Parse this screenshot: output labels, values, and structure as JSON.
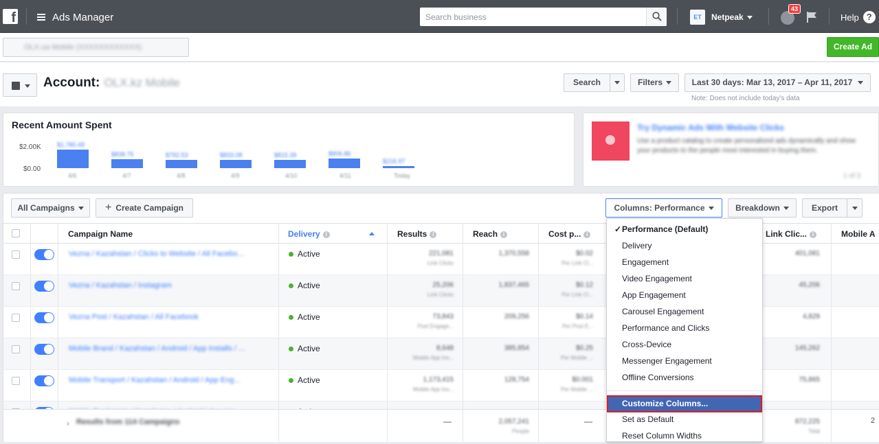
{
  "topbar": {
    "app_title": "Ads Manager",
    "search_placeholder": "Search business",
    "account_name": "Netpeak",
    "account_initials": "ET",
    "notification_count": "43",
    "help_label": "Help",
    "help_icon": "?"
  },
  "subbar": {
    "account_selector_text": "OLX.ua Mobile (XXXXXXXXXXXX)",
    "create_ad_label": "Create Ad"
  },
  "header": {
    "account_label": "Account:",
    "account_name": "OLX.kz Mobile",
    "search_label": "Search",
    "filters_label": "Filters",
    "date_range_label": "Last 30 days: Mar 13, 2017 – Apr 11, 2017",
    "note": "Note: Does not include today's data"
  },
  "spent": {
    "title": "Recent Amount Spent",
    "y_top": "$2.00K",
    "y_bottom": "$0.00"
  },
  "chart_data": {
    "type": "bar",
    "title": "Recent Amount Spent",
    "categories": [
      "4/6",
      "4/7",
      "4/8",
      "4/9",
      "4/10",
      "4/11",
      "Today"
    ],
    "values": [
      1780.49,
      838.75,
      792.53,
      833.08,
      815.39,
      906.86,
      216.97
    ],
    "value_labels": [
      "$1,780.49",
      "$838.75",
      "$792.53",
      "$833.08",
      "$815.39",
      "$906.86",
      "$216.97"
    ],
    "ylim": [
      0,
      2000
    ],
    "tick_labels": [
      "$2.00K",
      "$0.00"
    ]
  },
  "promo": {
    "title": "Try Dynamic Ads With Website Clicks",
    "body": "Use a product catalog to create personalized ads dynamically and show your products to the people most interested in buying them.",
    "pager": "1 of 3"
  },
  "toolbar": {
    "all_campaigns_label": "All Campaigns",
    "create_campaign_label": "Create Campaign",
    "columns_label": "Columns: Performance",
    "breakdown_label": "Breakdown",
    "export_label": "Export"
  },
  "table": {
    "headers": {
      "campaign_name": "Campaign Name",
      "delivery": "Delivery",
      "results": "Results",
      "reach": "Reach",
      "cost": "Cost p...",
      "link_clicks": "Link Clic...",
      "mobile": "Mobile A"
    },
    "rows": [
      {
        "name": "Vezna / Kazahstan / Clicks to Website / All Facebo...",
        "status": "Active",
        "results": "221,081",
        "results_sub": "Link Clicks",
        "reach": "1,370,558",
        "cost": "$0.02",
        "cost_sub": "Per Link Cl...",
        "link_clicks": "401,081"
      },
      {
        "name": "Vezna / Kazahstan / Instagram",
        "status": "Active",
        "results": "25,206",
        "results_sub": "Link Clicks",
        "reach": "1,837,465",
        "cost": "$0.12",
        "cost_sub": "Per Link Cl...",
        "link_clicks": "45,206"
      },
      {
        "name": "Vezna Post / Kazahstan / All Facebook",
        "status": "Active",
        "results": "73,843",
        "results_sub": "Post Engage...",
        "reach": "209,256",
        "cost": "$0.14",
        "cost_sub": "Per Post E...",
        "link_clicks": "4,829"
      },
      {
        "name": "Mobile Brand / Kazahstan / Android / App Installs / ...",
        "status": "Active",
        "results": "8,648",
        "results_sub": "Mobile App Ins...",
        "reach": "385,854",
        "cost": "$0.25",
        "cost_sub": "Per Mobile ...",
        "link_clicks": "145,262"
      },
      {
        "name": "Mobile Transport / Kazahstan / Android / App Eng...",
        "status": "Active",
        "results": "1,173,415",
        "results_sub": "Mobile App Ins...",
        "reach": "128,754",
        "cost": "$0.001",
        "cost_sub": "Per Mobile ...",
        "link_clicks": "75,865"
      },
      {
        "name": "Mobile Realestate / Kazahstan / Android / App Ins...",
        "status": "Active"
      }
    ],
    "footer": {
      "label": "Results from 114 Campaigns",
      "results": "—",
      "reach": "2,057,241",
      "reach_sub": "People",
      "cost": "—",
      "link_clicks": "872,225",
      "link_clicks_sub": "Total",
      "mobile": "2"
    }
  },
  "columns_menu": {
    "check_mark": "✓",
    "items": [
      "Performance (Default)",
      "Delivery",
      "Engagement",
      "Video Engagement",
      "App Engagement",
      "Carousel Engagement",
      "Performance and Clicks",
      "Cross-Device",
      "Messenger Engagement",
      "Offline Conversions"
    ],
    "customize_label": "Customize Columns...",
    "set_default_label": "Set as Default",
    "reset_label": "Reset Column Widths"
  },
  "colors": {
    "topbar": "#4b4f56",
    "accent_blue": "#4080ff",
    "create_green": "#42b72a",
    "highlight": "#4267b2",
    "highlight_border": "#e01a22"
  }
}
